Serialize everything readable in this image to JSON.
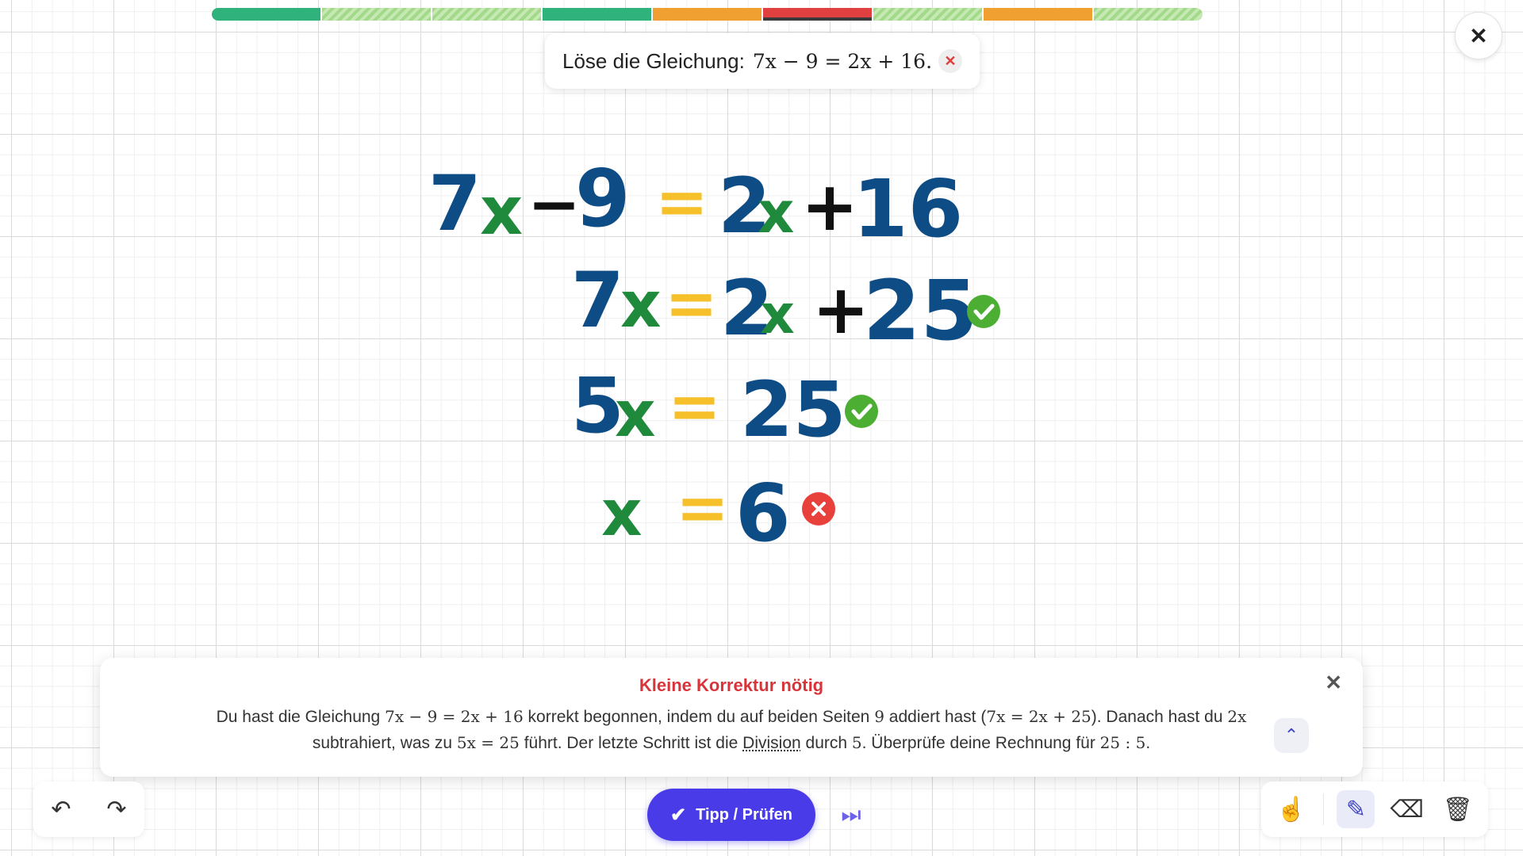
{
  "progress": {
    "segments": [
      {
        "state": "done",
        "color": "#2fb27b"
      },
      {
        "state": "hatched",
        "color": "#a3d98b"
      },
      {
        "state": "hatched",
        "color": "#a3d98b"
      },
      {
        "state": "done",
        "color": "#2fb27b"
      },
      {
        "state": "partial",
        "color": "#f0a030"
      },
      {
        "state": "wrong",
        "color": "#e04040",
        "current": true
      },
      {
        "state": "hatched",
        "color": "#a3d98b"
      },
      {
        "state": "partial",
        "color": "#f0a030"
      },
      {
        "state": "hatched",
        "color": "#a3d98b"
      }
    ]
  },
  "close_button": {
    "icon": "close-icon",
    "glyph": "✕"
  },
  "task": {
    "label": "Löse die Gleichung:",
    "equation": "7x − 9 = 2x + 16.",
    "dismiss_icon": "close-icon",
    "dismiss_glyph": "✕"
  },
  "workspace": {
    "colors": {
      "number": "#0e4c86",
      "variable": "#1f8a3c",
      "operator": "#111111",
      "equals": "#f5c02a",
      "correct": "#4caf33",
      "wrong": "#e8413c"
    },
    "lines": [
      {
        "tokens": [
          [
            "7",
            "number"
          ],
          [
            "x",
            "variable"
          ],
          [
            "−",
            "operator"
          ],
          [
            "9",
            "number"
          ],
          [
            "=",
            "equals"
          ],
          [
            "2",
            "number"
          ],
          [
            "x",
            "variable"
          ],
          [
            "+",
            "operator"
          ],
          [
            "16",
            "number"
          ]
        ],
        "status": "none"
      },
      {
        "tokens": [
          [
            "7",
            "number"
          ],
          [
            "x",
            "variable"
          ],
          [
            "=",
            "equals"
          ],
          [
            "2",
            "number"
          ],
          [
            "x",
            "variable"
          ],
          [
            "+",
            "operator"
          ],
          [
            "25",
            "number"
          ]
        ],
        "status": "correct"
      },
      {
        "tokens": [
          [
            "5",
            "number"
          ],
          [
            "x",
            "variable"
          ],
          [
            "=",
            "equals"
          ],
          [
            "25",
            "number"
          ]
        ],
        "status": "correct"
      },
      {
        "tokens": [
          [
            "x",
            "variable"
          ],
          [
            "=",
            "equals"
          ],
          [
            "6",
            "number"
          ]
        ],
        "status": "wrong"
      }
    ]
  },
  "feedback": {
    "title": "Kleine Korrektur nötig",
    "text_1": "Du hast die Gleichung",
    "math_1": "7x − 9 = 2x + 16",
    "text_2": "korrekt begonnen, indem du auf beiden Seiten",
    "math_2": "9",
    "text_3": "addiert hast (",
    "math_3": "7x = 2x + 25",
    "text_4": "). Danach hast du",
    "math_4": "2x",
    "text_5": "subtrahiert, was zu",
    "math_5": "5x = 25",
    "text_6": "führt. Der letzte Schritt ist die",
    "link": "Division",
    "text_7": "durch",
    "math_6": "5",
    "text_8": ". Überprüfe deine Rechnung für",
    "math_7": "25 : 5",
    "text_9": ".",
    "close_glyph": "✕",
    "expand_glyph": "⌃"
  },
  "toolbar": {
    "undo_glyph": "↶",
    "redo_glyph": "↷",
    "primary_label": "Tipp / Prüfen",
    "primary_glyph": "✔",
    "skip_glyph": "⏭",
    "hand_glyph": "☝",
    "pen_glyph": "✎",
    "eraser_glyph": "⌫",
    "trash_glyph": "🗑"
  }
}
